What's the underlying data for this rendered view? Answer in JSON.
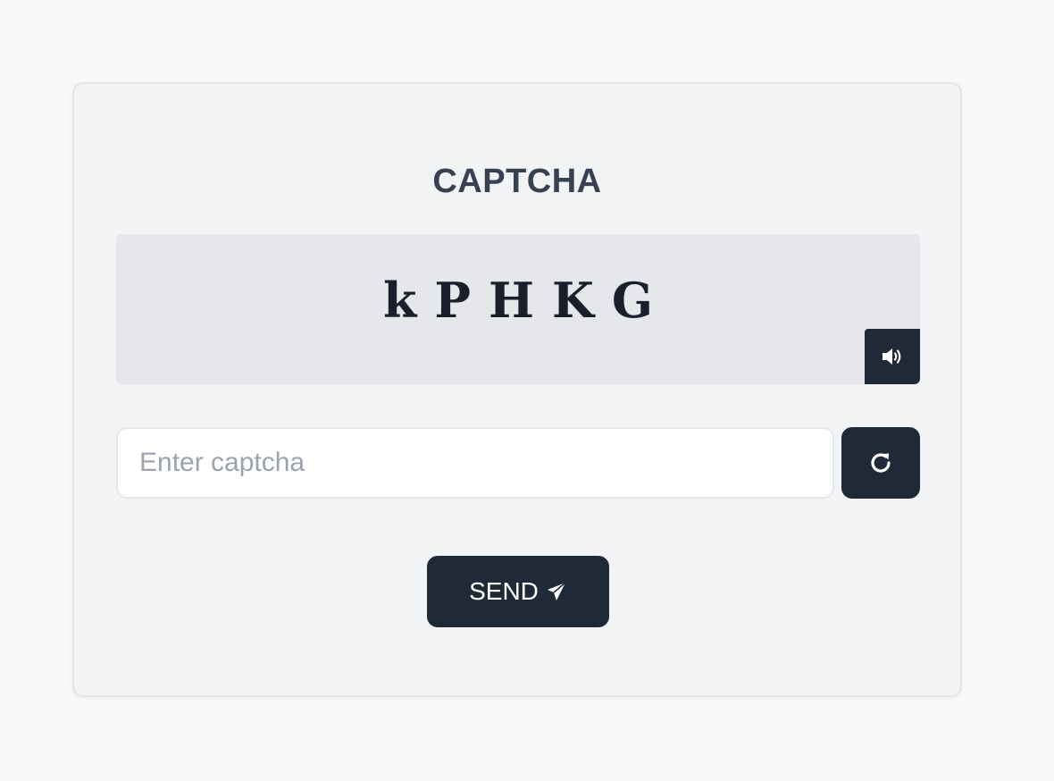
{
  "card": {
    "title": "CAPTCHA",
    "captcha_code": "kPHKG",
    "audio_icon": "speaker-volume-icon"
  },
  "input": {
    "placeholder": "Enter captcha",
    "value": ""
  },
  "refresh": {
    "icon": "refresh-icon"
  },
  "send": {
    "label": "SEND",
    "icon": "paper-plane-icon"
  },
  "colors": {
    "background": "#f8f9fb",
    "card": "#f2f3f5",
    "captcha_box": "#e5e7eb",
    "button": "#1f2937",
    "title": "#374151",
    "placeholder": "#9ca3af"
  }
}
